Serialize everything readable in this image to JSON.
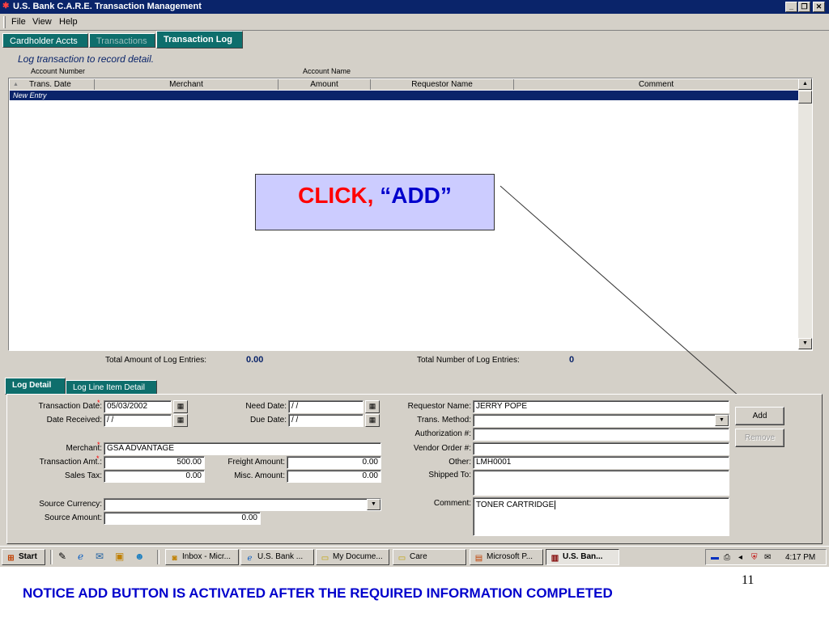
{
  "window": {
    "title": "U.S. Bank C.A.R.E. Transaction Management",
    "minimize_glyph": "_",
    "restore_glyph": "❐",
    "close_glyph": "✕"
  },
  "menubar": {
    "items": [
      "File",
      "View",
      "Help"
    ]
  },
  "top_tabs": [
    {
      "label": "Cardholder Accts",
      "state": "normal"
    },
    {
      "label": "Transactions",
      "state": "disabled"
    },
    {
      "label": "Transaction Log",
      "state": "active"
    }
  ],
  "log_panel": {
    "title": "Log transaction to record detail.",
    "account_number_label": "Account Number",
    "account_name_label": "Account Name",
    "columns": [
      "Trans. Date",
      "Merchant",
      "Amount",
      "Requestor Name",
      "Comment"
    ],
    "sort_glyph": "▲",
    "selected_row": "New Entry",
    "total_amount_label": "Total Amount of Log Entries:",
    "total_amount_value": "0.00",
    "total_number_label": "Total Number of Log Entries:",
    "total_number_value": "0"
  },
  "callout": {
    "word1": "CLICK,",
    "word2": "“ADD”"
  },
  "detail_tabs": [
    {
      "label": "Log Detail",
      "state": "active"
    },
    {
      "label": "Log Line Item Detail",
      "state": "normal"
    }
  ],
  "form": {
    "transaction_date": {
      "label": "Transaction Date:",
      "value": "05/03/2002"
    },
    "date_received": {
      "label": "Date Received:",
      "value": " / /"
    },
    "need_date": {
      "label": "Need Date:",
      "value": " / /"
    },
    "due_date": {
      "label": "Due Date:",
      "value": " / /"
    },
    "merchant": {
      "label": "Merchant:",
      "value": "GSA ADVANTAGE"
    },
    "transaction_amt": {
      "label": "Transaction Amt.:",
      "value": "500.00"
    },
    "sales_tax": {
      "label": "Sales Tax:",
      "value": "0.00"
    },
    "freight_amount": {
      "label": "Freight Amount:",
      "value": "0.00"
    },
    "misc_amount": {
      "label": "Misc. Amount:",
      "value": "0.00"
    },
    "source_currency": {
      "label": "Source Currency:",
      "value": ""
    },
    "source_amount": {
      "label": "Source Amount:",
      "value": "0.00"
    },
    "requestor_name": {
      "label": "Requestor Name:",
      "value": "JERRY POPE"
    },
    "trans_method": {
      "label": "Trans. Method:",
      "value": ""
    },
    "authorization": {
      "label": "Authorization #:",
      "value": ""
    },
    "vendor_order": {
      "label": "Vendor Order #:",
      "value": ""
    },
    "other": {
      "label": "Other:",
      "value": "LMH0001"
    },
    "shipped_to": {
      "label": "Shipped To:",
      "value": ""
    },
    "comment": {
      "label": "Comment:",
      "value": "TONER CARTRIDGE"
    },
    "required_mark": "*",
    "calendar_glyph": "▦",
    "dropdown_glyph": "▼"
  },
  "buttons": {
    "add": "Add",
    "remove": "Remove"
  },
  "taskbar": {
    "start": "Start",
    "tasks": [
      {
        "label": "Inbox - Micr...",
        "icon": "outlook-icon",
        "pressed": false
      },
      {
        "label": "U.S. Bank ...",
        "icon": "ie-icon",
        "pressed": false
      },
      {
        "label": "My Docume...",
        "icon": "folder-icon",
        "pressed": false
      },
      {
        "label": "Care",
        "icon": "folder-icon",
        "pressed": false
      },
      {
        "label": "Microsoft P...",
        "icon": "powerpoint-icon",
        "pressed": false
      },
      {
        "label": "U.S. Ban...",
        "icon": "app-icon",
        "pressed": true
      }
    ],
    "clock": "4:17 PM"
  },
  "footnote": "NOTICE ADD BUTTON IS ACTIVATED AFTER THE REQUIRED INFORMATION COMPLETED",
  "slide_number": "11",
  "colors": {
    "titlebar": "#0a246a",
    "tab_teal": "#0e6e6c",
    "chrome_gray": "#d4d0c8",
    "callout_bg": "#ccccff",
    "callout_red": "#ff0000",
    "callout_blue": "#0000cc",
    "footnote_blue": "#0000cc"
  }
}
